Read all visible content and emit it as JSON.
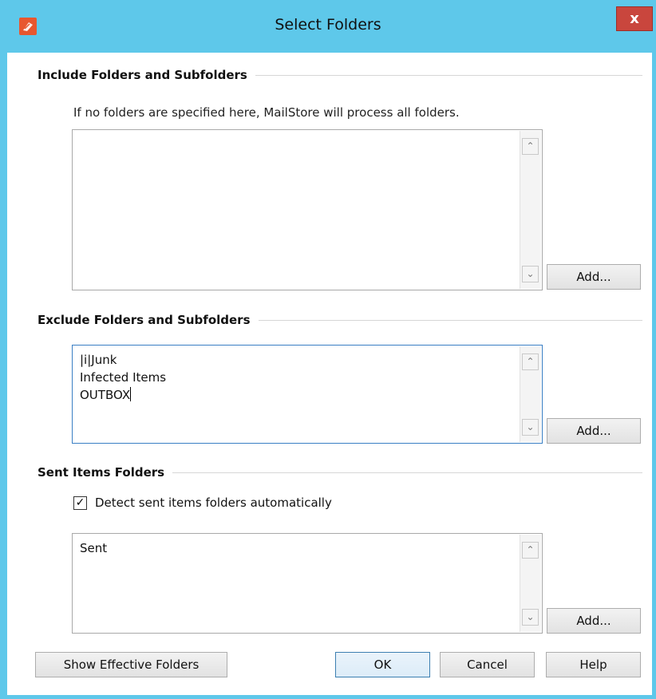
{
  "window": {
    "title": "Select Folders",
    "close_label": "x"
  },
  "include": {
    "title": "Include Folders and Subfolders",
    "hint": "If no folders are specified here, MailStore will process all folders.",
    "items": [],
    "add_label": "Add..."
  },
  "exclude": {
    "title": "Exclude Folders and Subfolders",
    "items": [
      "|i|Junk",
      "Infected Items",
      "OUTBOX"
    ],
    "add_label": "Add..."
  },
  "sent": {
    "title": "Sent Items Folders",
    "detect_label": "Detect sent items folders automatically",
    "detect_checked": true,
    "items": [
      "Sent"
    ],
    "add_label": "Add..."
  },
  "footer": {
    "show_effective_label": "Show Effective Folders",
    "ok_label": "OK",
    "cancel_label": "Cancel",
    "help_label": "Help"
  },
  "icons": {
    "app": "mailstore-app-icon",
    "close": "close-icon",
    "scroll_up": "chevron-up-icon",
    "scroll_down": "chevron-down-icon",
    "check": "checkmark-icon"
  }
}
